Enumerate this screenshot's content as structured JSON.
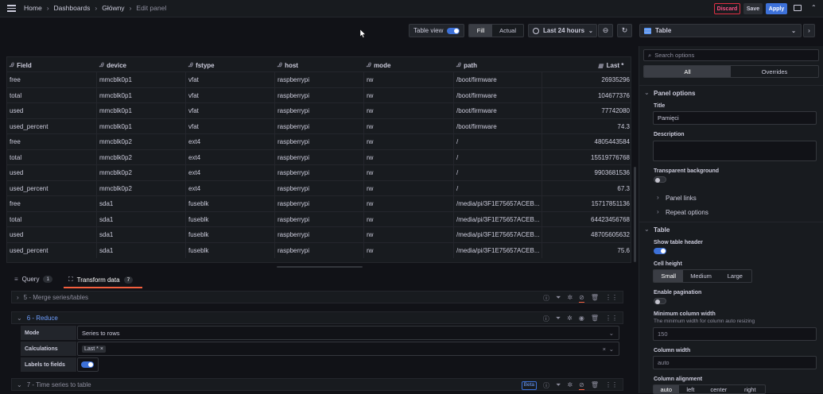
{
  "breadcrumb": {
    "home": "Home",
    "dashboards": "Dashboards",
    "folder": "Główny",
    "current": "Edit panel"
  },
  "topbar": {
    "discard": "Discard",
    "save": "Save",
    "apply": "Apply"
  },
  "toolbar": {
    "table_view": "Table view",
    "fill": "Fill",
    "actual": "Actual",
    "time_range": "Last 24 hours"
  },
  "viz": {
    "name": "Table"
  },
  "table": {
    "headers": [
      "Field",
      "device",
      "fstype",
      "host",
      "mode",
      "path",
      "Last *"
    ],
    "rows": [
      [
        "free",
        "mmcblk0p1",
        "vfat",
        "raspberrypi",
        "rw",
        "/boot/firmware",
        "26935296"
      ],
      [
        "total",
        "mmcblk0p1",
        "vfat",
        "raspberrypi",
        "rw",
        "/boot/firmware",
        "104677376"
      ],
      [
        "used",
        "mmcblk0p1",
        "vfat",
        "raspberrypi",
        "rw",
        "/boot/firmware",
        "77742080"
      ],
      [
        "used_percent",
        "mmcblk0p1",
        "vfat",
        "raspberrypi",
        "rw",
        "/boot/firmware",
        "74.3"
      ],
      [
        "free",
        "mmcblk0p2",
        "ext4",
        "raspberrypi",
        "rw",
        "/",
        "4805443584"
      ],
      [
        "total",
        "mmcblk0p2",
        "ext4",
        "raspberrypi",
        "rw",
        "/",
        "15519776768"
      ],
      [
        "used",
        "mmcblk0p2",
        "ext4",
        "raspberrypi",
        "rw",
        "/",
        "9903681536"
      ],
      [
        "used_percent",
        "mmcblk0p2",
        "ext4",
        "raspberrypi",
        "rw",
        "/",
        "67.3"
      ],
      [
        "free",
        "sda1",
        "fuseblk",
        "raspberrypi",
        "rw",
        "/media/pi/3F1E75657ACEB...",
        "15717851136"
      ],
      [
        "total",
        "sda1",
        "fuseblk",
        "raspberrypi",
        "rw",
        "/media/pi/3F1E75657ACEB...",
        "64423456768"
      ],
      [
        "used",
        "sda1",
        "fuseblk",
        "raspberrypi",
        "rw",
        "/media/pi/3F1E75657ACEB...",
        "48705605632"
      ],
      [
        "used_percent",
        "sda1",
        "fuseblk",
        "raspberrypi",
        "rw",
        "/media/pi/3F1E75657ACEB...",
        "75.6"
      ]
    ]
  },
  "tabs": {
    "query": "Query",
    "query_count": "1",
    "transform": "Transform data",
    "transform_count": "7"
  },
  "transforms": {
    "t5": "5 - Merge series/tables",
    "t6": "6 - Reduce",
    "mode_label": "Mode",
    "mode_value": "Series to rows",
    "calc_label": "Calculations",
    "calc_value": "Last *",
    "labels_label": "Labels to fields",
    "t7": "7 - Time series to table",
    "beta": "Beta"
  },
  "options": {
    "search_placeholder": "Search options",
    "tab_all": "All",
    "tab_overrides": "Overrides",
    "panel_options": "Panel options",
    "title_label": "Title",
    "title_value": "Pamięci",
    "description_label": "Description",
    "transparent_label": "Transparent background",
    "panel_links": "Panel links",
    "repeat_options": "Repeat options",
    "table_section": "Table",
    "show_header": "Show table header",
    "cell_height": "Cell height",
    "small": "Small",
    "medium": "Medium",
    "large": "Large",
    "pagination": "Enable pagination",
    "min_width_label": "Minimum column width",
    "min_width_desc": "The minimum width for column auto resizing",
    "min_width_value": "150",
    "col_width_label": "Column width",
    "col_width_value": "auto",
    "col_align_label": "Column alignment",
    "align": [
      "auto",
      "left",
      "center",
      "right"
    ]
  },
  "colors": {
    "accent": "#3d71d9",
    "discard": "#e02f44",
    "orange": "#f55f3e",
    "bg": "#111217",
    "panel": "#181b1f"
  }
}
